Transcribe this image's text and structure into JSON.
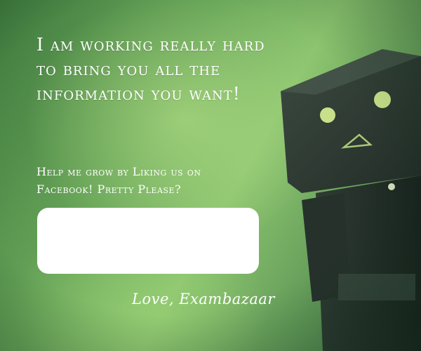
{
  "headline": "I am working really hard to bring you all the information you want!",
  "subline": "Help me grow by Liking us on Facebook! Pretty Please?",
  "signature": "Love, Exambazaar",
  "colors": {
    "background_green": "#6aa75a",
    "text": "#ffffff",
    "robot_body": "#2c3a32"
  }
}
